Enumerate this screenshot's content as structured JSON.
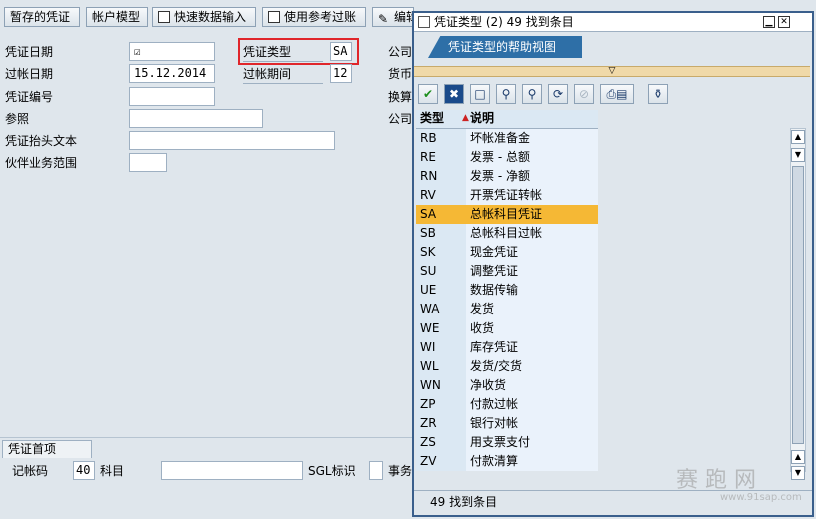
{
  "toolbar": {
    "buttons": [
      "暂存的凭证",
      "帐户模型",
      "快速数据输入",
      "使用参考过账",
      "编辑选项"
    ]
  },
  "form": {
    "doc_date_label": "凭证日期",
    "doc_date_value": "",
    "doc_date_icon": "calendar-check-icon",
    "post_date_label": "过帐日期",
    "post_date_value": "15.12.2014",
    "doc_no_label": "凭证编号",
    "doc_no_value": "",
    "reference_label": "参照",
    "reference_value": "",
    "header_text_label": "凭证抬头文本",
    "header_text_value": "",
    "partner_label": "伙伴业务范围",
    "partner_value": "",
    "doc_type_label": "凭证类型",
    "doc_type_value": "SA",
    "period_label": "过帐期间",
    "period_value": "12",
    "company_label": "公司",
    "currency_label": "货币",
    "exchange_label": "换算",
    "company2_label": "公司"
  },
  "bottom": {
    "tab_label": "凭证首项",
    "posting_key_label": "记帐码",
    "posting_key_value": "40",
    "account_label": "科目",
    "account_value": "",
    "sgl_label": "SGL标识",
    "sgl_value": "",
    "trans_label": "事务"
  },
  "popup": {
    "title": "凭证类型 (2)   49 找到条目",
    "help_tab": "凭证类型的帮助视图",
    "col_type": "类型",
    "col_desc": "说明",
    "rows": [
      {
        "type": "RB",
        "desc": "坏帐准备金"
      },
      {
        "type": "RE",
        "desc": "发票 - 总额"
      },
      {
        "type": "RN",
        "desc": "发票 - 净额"
      },
      {
        "type": "RV",
        "desc": "开票凭证转帐"
      },
      {
        "type": "SA",
        "desc": "总帐科目凭证"
      },
      {
        "type": "SB",
        "desc": "总帐科目过帐"
      },
      {
        "type": "SK",
        "desc": "现金凭证"
      },
      {
        "type": "SU",
        "desc": "调整凭证"
      },
      {
        "type": "UE",
        "desc": "数据传输"
      },
      {
        "type": "WA",
        "desc": "发货"
      },
      {
        "type": "WE",
        "desc": "收货"
      },
      {
        "type": "WI",
        "desc": "库存凭证"
      },
      {
        "type": "WL",
        "desc": "发货/交货"
      },
      {
        "type": "WN",
        "desc": "净收货"
      },
      {
        "type": "ZP",
        "desc": "付款过帐"
      },
      {
        "type": "ZR",
        "desc": "银行对帐"
      },
      {
        "type": "ZS",
        "desc": "用支票支付"
      },
      {
        "type": "ZV",
        "desc": "付款清算"
      }
    ],
    "selected_type": "SA",
    "status": "49 找到条目",
    "tool_icons": [
      "check-icon",
      "cancel-icon",
      "new-icon",
      "find-icon",
      "find-next-icon",
      "refresh-icon",
      "disabled-icon",
      "print-icon",
      "info-icon"
    ]
  },
  "watermark": {
    "text": "赛 跑 网",
    "url": "www.91sap.com"
  },
  "colors": {
    "highlight": "#f5b835",
    "red_box": "#e0262b",
    "title_blue": "#2e6fa7"
  }
}
